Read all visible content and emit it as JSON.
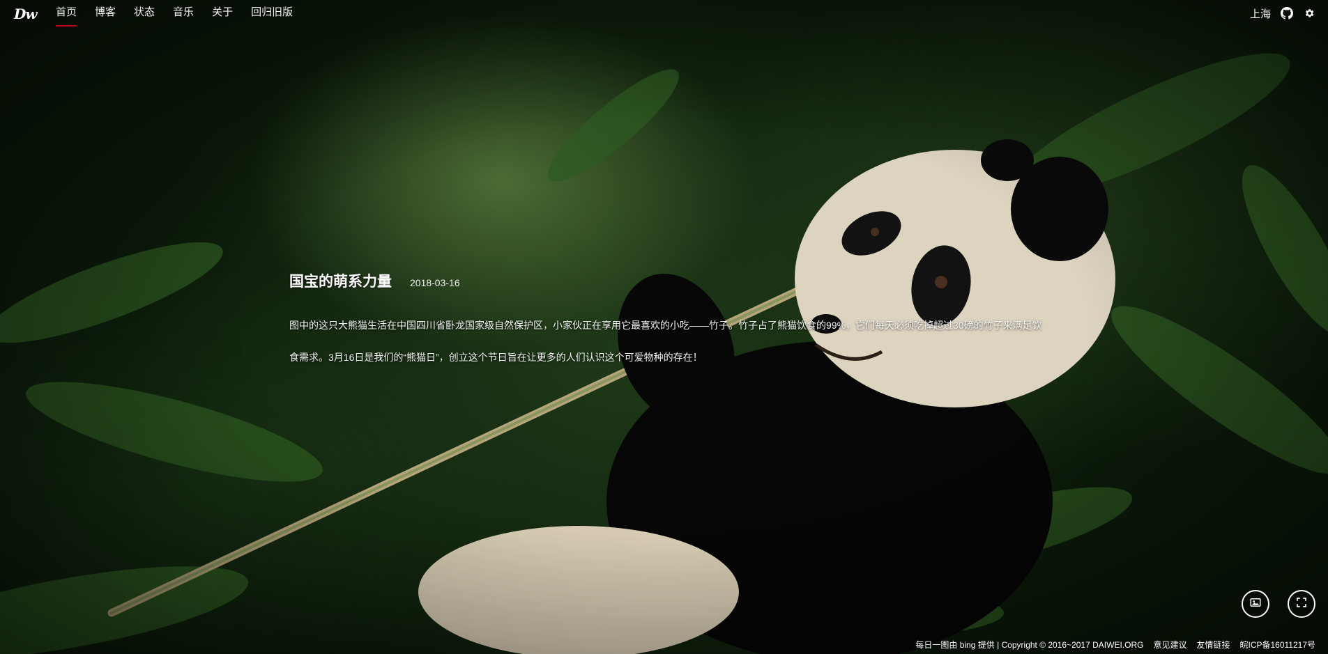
{
  "nav": {
    "logo": "Dw",
    "items": [
      {
        "label": "首页",
        "active": true
      },
      {
        "label": "博客"
      },
      {
        "label": "状态"
      },
      {
        "label": "音乐"
      },
      {
        "label": "关于"
      },
      {
        "label": "回归旧版"
      }
    ],
    "city": "上海",
    "icons": [
      "github-icon",
      "settings-icon"
    ]
  },
  "story": {
    "title": "国宝的萌系力量",
    "date": "2018-03-16",
    "body": "图中的这只大熊猫生活在中国四川省卧龙国家级自然保护区，小家伙正在享用它最喜欢的小吃——竹子。竹子占了熊猫饮食的99%，它们每天必须吃掉超过30磅的竹子来满足饮食需求。3月16日是我们的“熊猫日”，创立这个节日旨在让更多的人们认识这个可爱物种的存在！"
  },
  "buttons": {
    "gallery_icon": "image-icon",
    "fullscreen_icon": "fullscreen-icon"
  },
  "footer": {
    "credit": "每日一图由 bing 提供 | Copyright © 2016~2017 DAIWEI.ORG",
    "feedback": "意见建议",
    "links": "友情链接",
    "icp": "皖ICP备16011217号"
  },
  "colors": {
    "accent": "#d0021b",
    "text": "#ffffff"
  }
}
